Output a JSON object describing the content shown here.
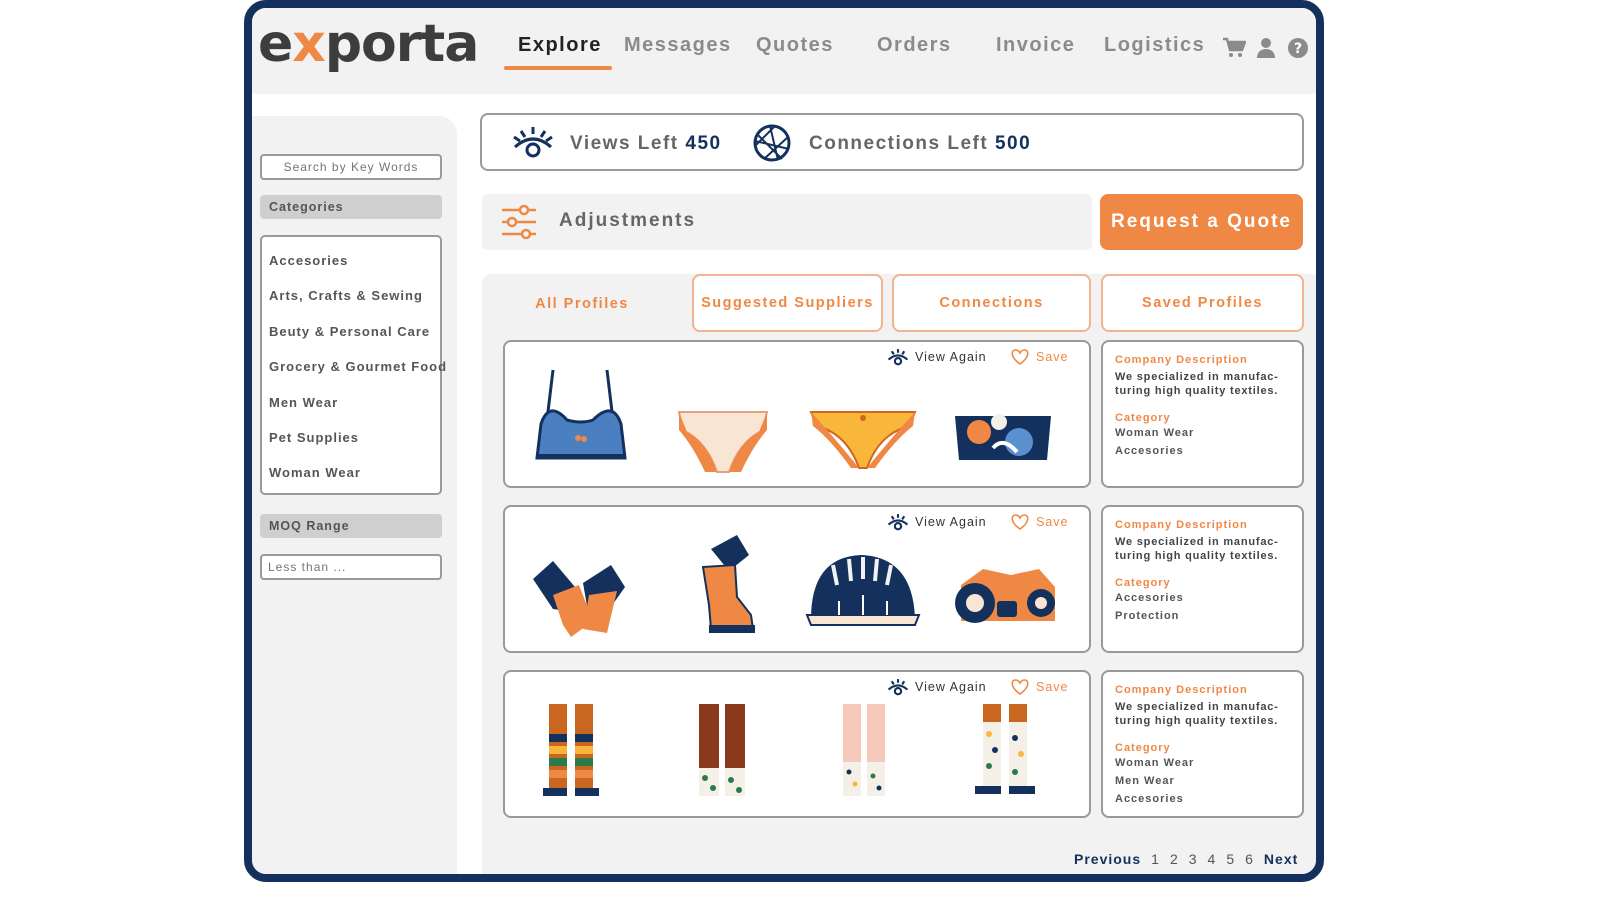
{
  "app": {
    "logo_pre": "e",
    "logo_x": "x",
    "logo_post": "porta"
  },
  "nav": [
    {
      "label": "Explore"
    },
    {
      "label": "Messages"
    },
    {
      "label": "Quotes"
    },
    {
      "label": "Orders"
    },
    {
      "label": "Invoice"
    },
    {
      "label": "Logistics"
    }
  ],
  "top_icons": [
    "cart-icon",
    "user-icon",
    "help-icon"
  ],
  "sidebar": {
    "search_placeholder": "Search by Key Words",
    "categories_header": "Categories",
    "categories": [
      "Accesories",
      "Arts, Crafts & Sewing",
      "Beuty & Personal Care",
      "Grocery & Gourmet Food",
      "Men Wear",
      "Pet Supplies",
      "Woman Wear"
    ],
    "moq_header": "MOQ Range",
    "moq_placeholder": "Less than ..."
  },
  "stats": {
    "views_label": "Views Left",
    "views_value": "450",
    "connections_label": "Connections Left",
    "connections_value": "500"
  },
  "adjustments_label": "Adjustments",
  "request_quote_label": "Request a Quote",
  "tabs": [
    "All Profiles",
    "Suggested Suppliers",
    "Connections",
    "Saved Profiles"
  ],
  "cards": [
    {
      "view_again": "View Again",
      "save": "Save",
      "products": [
        "bra",
        "briefs",
        "thong",
        "bandeau top"
      ],
      "desc_heading": "Company Description",
      "desc_line1": "We specialized in manufac-",
      "desc_line2": "turing high quality textiles.",
      "category_heading": "Category",
      "categories": [
        "Woman Wear",
        "Accesories"
      ]
    },
    {
      "view_again": "View Again",
      "save": "Save",
      "products": [
        "gloves",
        "boots",
        "hard hat",
        "respirator"
      ],
      "desc_heading": "Company Description",
      "desc_line1": "We specialized in manufac-",
      "desc_line2": "turing high quality textiles.",
      "category_heading": "Category",
      "categories": [
        "Accesories",
        "Protection"
      ]
    },
    {
      "view_again": "View Again",
      "save": "Save",
      "products": [
        "striped socks",
        "leopard socks",
        "pink dotted socks",
        "dotted socks"
      ],
      "desc_heading": "Company Description",
      "desc_line1": "We specialized in manufac-",
      "desc_line2": "turing high quality textiles.",
      "category_heading": "Category",
      "categories": [
        "Woman Wear",
        "Men Wear",
        "Accesories"
      ]
    }
  ],
  "pagination": {
    "prev": "Previous",
    "pages": [
      "1",
      "2",
      "3",
      "4",
      "5",
      "6"
    ],
    "next": "Next"
  },
  "colors": {
    "accent": "#f08845",
    "navy": "#13315c",
    "panel": "#f2f2f2"
  }
}
